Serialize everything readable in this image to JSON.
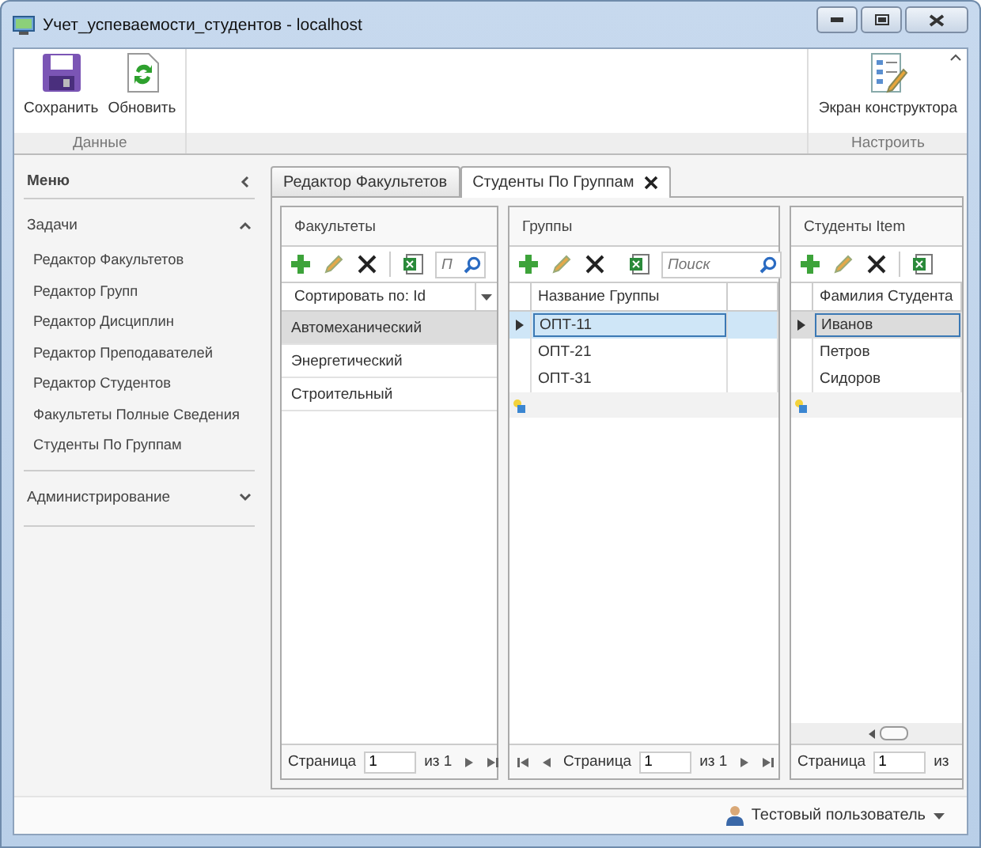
{
  "window": {
    "title": "Учет_успеваемости_студентов - localhost"
  },
  "ribbon": {
    "groups": [
      {
        "label": "Данные",
        "buttons": [
          {
            "label": "Сохранить"
          },
          {
            "label": "Обновить"
          }
        ]
      },
      {
        "label": "Настроить",
        "buttons": [
          {
            "label": "Экран конструктора"
          }
        ]
      }
    ]
  },
  "sidebar": {
    "title": "Меню",
    "sections": [
      {
        "label": "Задачи",
        "expanded": true,
        "items": [
          {
            "label": "Редактор Факультетов"
          },
          {
            "label": "Редактор Групп"
          },
          {
            "label": "Редактор Дисциплин"
          },
          {
            "label": "Редактор Преподавателей"
          },
          {
            "label": "Редактор Студентов"
          },
          {
            "label": "Факультеты Полные Сведения"
          },
          {
            "label": "Студенты По Группам"
          }
        ]
      },
      {
        "label": "Администрирование",
        "expanded": false
      }
    ]
  },
  "tabs": [
    {
      "label": "Редактор Факультетов",
      "selected": false,
      "closable": false
    },
    {
      "label": "Студенты По Группам",
      "selected": true,
      "closable": true
    }
  ],
  "panels": [
    {
      "kind": "list",
      "title": "Факультеты",
      "search": {
        "placeholder": "П"
      },
      "sort": "Сортировать по: Id",
      "rows": [
        {
          "text": "Автомеханический",
          "selected": true
        },
        {
          "text": "Энергетический",
          "selected": false
        },
        {
          "text": "Строительный",
          "selected": false
        }
      ],
      "pager": {
        "label": "Страница",
        "value": "1",
        "total": "из 1",
        "first_prev": false,
        "next_last": true
      }
    },
    {
      "kind": "grid",
      "title": "Группы",
      "search": {
        "placeholder": "Поиск"
      },
      "column": "Название Группы",
      "rows": [
        {
          "text": "ОПТ-11",
          "selected": true
        },
        {
          "text": "ОПТ-21",
          "selected": false
        },
        {
          "text": "ОПТ-31",
          "selected": false
        }
      ],
      "pager": {
        "label": "Страница",
        "value": "1",
        "total": "из 1",
        "first_prev": true,
        "next_last": true
      }
    },
    {
      "kind": "grid",
      "title": "Студенты Item",
      "column": "Фамилия Студента",
      "scrollbar": true,
      "rows": [
        {
          "text": "Иванов",
          "selected": true
        },
        {
          "text": "Петров",
          "selected": false
        },
        {
          "text": "Сидоров",
          "selected": false
        }
      ],
      "pager": {
        "label": "Страница",
        "value": "1",
        "total": "из",
        "first_prev": false,
        "next_last": false
      }
    }
  ],
  "status_bar": {
    "user": "Тестовый пользователь"
  }
}
